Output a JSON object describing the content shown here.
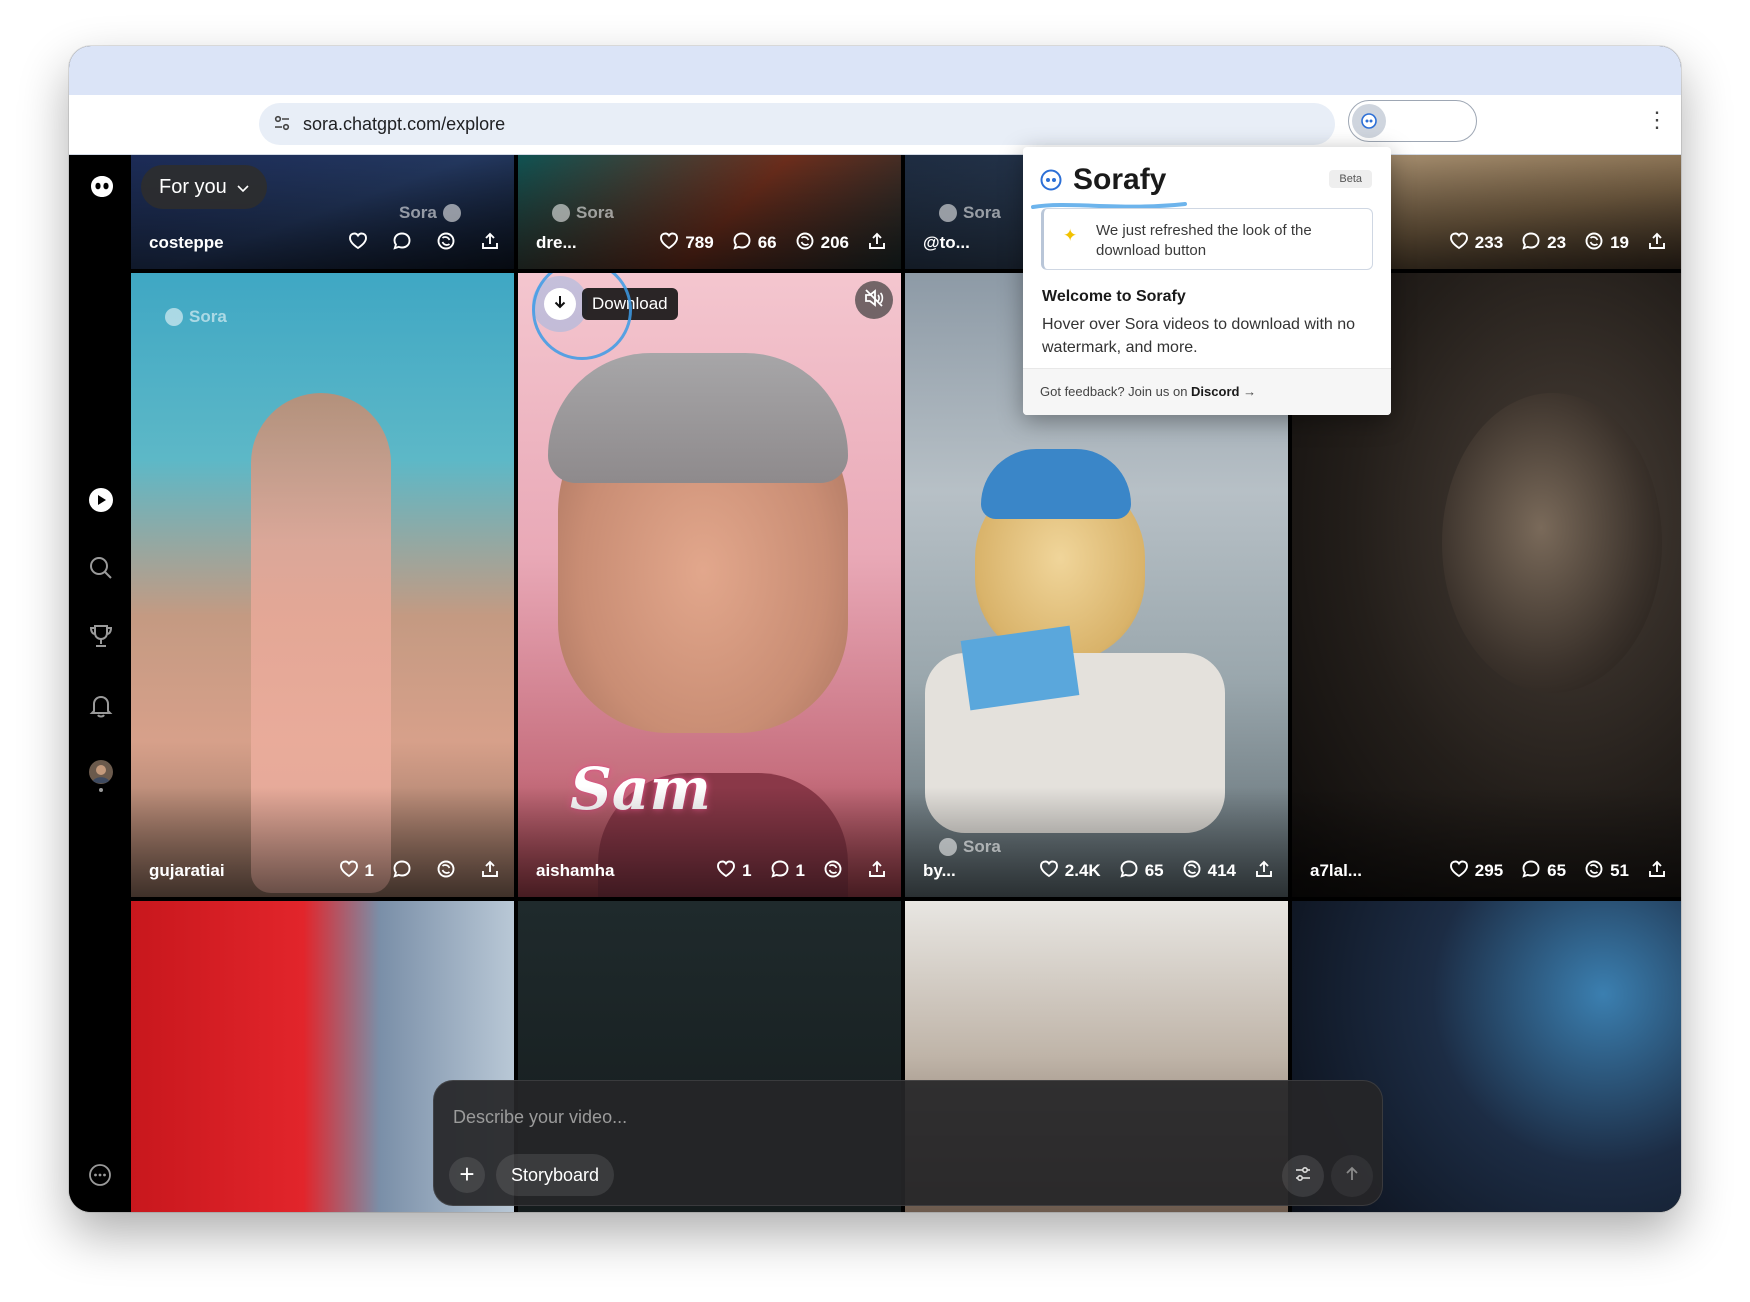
{
  "browser": {
    "url": "sora.chatgpt.com/explore"
  },
  "feed_header": {
    "tab_label": "For you"
  },
  "watermark": {
    "brand": "Sora"
  },
  "tiles_top": [
    {
      "author": "costeppe",
      "likes": "",
      "comments": "",
      "remixes": ""
    },
    {
      "author": "dre...",
      "likes": "789",
      "comments": "66",
      "remixes": "206"
    },
    {
      "author": "@to...",
      "likes": "",
      "comments": "",
      "remixes": ""
    },
    {
      "author": "",
      "likes": "233",
      "comments": "23",
      "remixes": "19"
    }
  ],
  "tiles_mid": [
    {
      "author": "gujaratiai",
      "likes": "1",
      "comments": "",
      "remixes": ""
    },
    {
      "author": "aishamha",
      "likes": "1",
      "comments": "1",
      "remixes": "",
      "overlay_text": "Sam"
    },
    {
      "author": "by...",
      "likes": "2.4K",
      "comments": "65",
      "remixes": "414"
    },
    {
      "author": "a7lal...",
      "likes": "295",
      "comments": "65",
      "remixes": "51"
    }
  ],
  "download": {
    "label": "Download"
  },
  "sorafy": {
    "title": "Sorafy",
    "badge": "Beta",
    "notice": "We just refreshed the look of the download button",
    "welcome_title": "Welcome to Sorafy",
    "welcome_desc": "Hover over Sora videos to download with no watermark, and more.",
    "footer_text": "Got feedback? Join us on ",
    "footer_link": "Discord",
    "footer_arrow": "→"
  },
  "composer": {
    "placeholder": "Describe your video...",
    "add_symbol": "+",
    "storyboard_label": "Storyboard"
  },
  "colors": {
    "accent": "#3c9be6",
    "tabstrip": "#dbe4f7",
    "background": "#000000"
  },
  "icons": {
    "rail": [
      "sora-logo-icon",
      "explore-play-icon",
      "search-icon",
      "trophy-icon",
      "bell-icon",
      "avatar",
      "more-icon"
    ],
    "stats": [
      "heart-icon",
      "comment-icon",
      "remix-icon",
      "share-icon"
    ]
  }
}
